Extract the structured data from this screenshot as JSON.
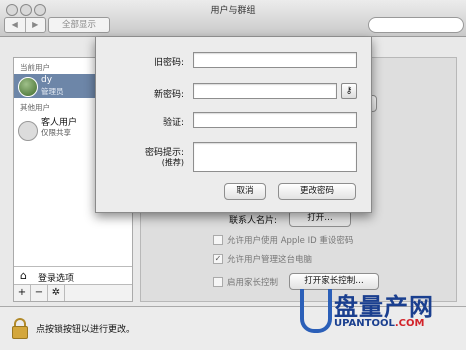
{
  "window": {
    "title": "用户与群组"
  },
  "toolbar": {
    "back_glyph": "◀",
    "forward_glyph": "▶",
    "show_all_label": "全部显示",
    "search_placeholder": ""
  },
  "sidebar": {
    "current_users_label": "当前用户",
    "current_user": {
      "name": "dy",
      "role": "管理员"
    },
    "other_users_label": "其他用户",
    "guest": {
      "name": "客人用户",
      "detail": "仅限共享"
    },
    "login_options_label": "登录选项",
    "tools": [
      "+",
      "−",
      "✲"
    ]
  },
  "right_panel": {
    "contact_card_label": "联系人名片:",
    "open_button_label": "打开…",
    "checkboxes": [
      {
        "label": "允许用户使用 Apple ID 重设密码",
        "checked": false
      },
      {
        "label": "允许用户管理这台电脑",
        "checked": true
      },
      {
        "label": "启用家长控制",
        "checked": false
      }
    ],
    "parental_controls_button": "打开家长控制…"
  },
  "bottom": {
    "lock_text": "点按锁按钮以进行更改。"
  },
  "dialog": {
    "old_password_label": "旧密码:",
    "new_password_label": "新密码:",
    "verify_label": "验证:",
    "hint_label": "密码提示:",
    "hint_sublabel": "(推荐)",
    "key_glyph": "⚷",
    "cancel_label": "取消",
    "change_password_label": "更改密码",
    "old_password_value": "",
    "new_password_value": "",
    "verify_value": "",
    "hint_value": ""
  },
  "watermark": {
    "brand": "盘量产网",
    "url_main": "UPANTOOL",
    "url_domain": ".COM"
  },
  "colors": {
    "accent_selection": "#6d86a8",
    "watermark_blue": "#1a3f8f",
    "watermark_red": "#d2232a"
  }
}
